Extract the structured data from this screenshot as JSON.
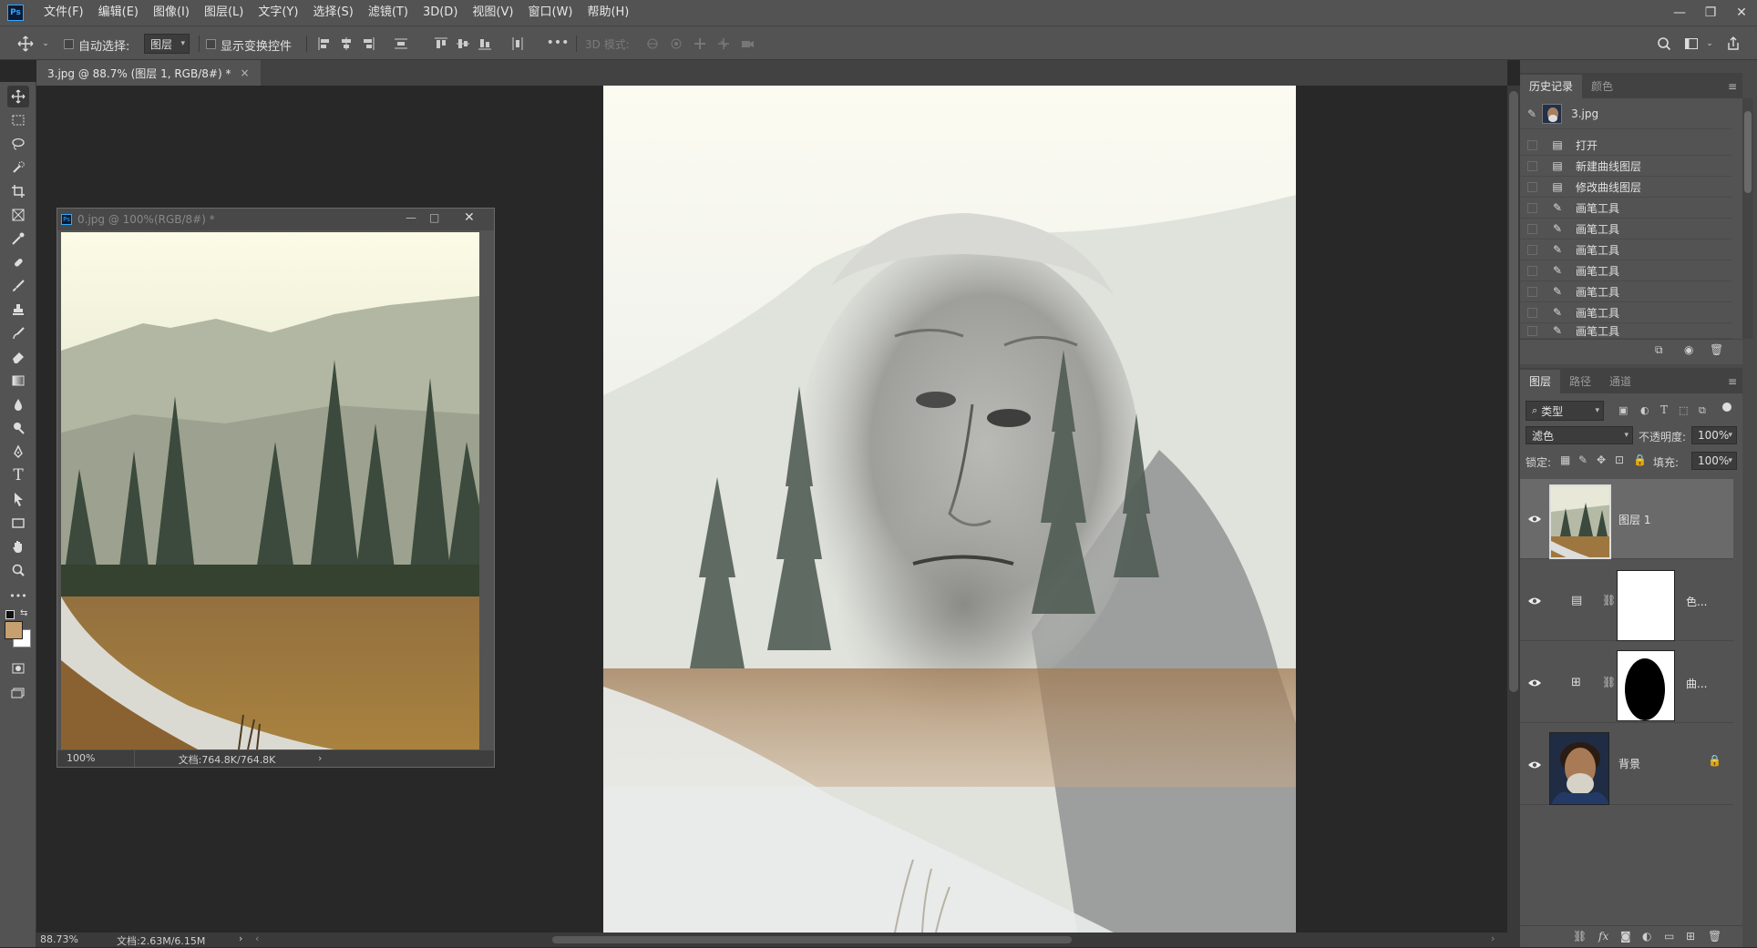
{
  "app": {
    "logo": "Ps"
  },
  "menu": [
    "文件(F)",
    "编辑(E)",
    "图像(I)",
    "图层(L)",
    "文字(Y)",
    "选择(S)",
    "滤镜(T)",
    "3D(D)",
    "视图(V)",
    "窗口(W)",
    "帮助(H)"
  ],
  "window_controls": [
    "—",
    "❐",
    "✕"
  ],
  "options": {
    "auto_select_label": "自动选择:",
    "auto_select_target": "图层",
    "show_transform_label": "显示变换控件",
    "more": "•••",
    "mode_3d_label": "3D 模式:"
  },
  "document_tab": {
    "title": "3.jpg @ 88.7% (图层 1, RGB/8#) *",
    "close": "×"
  },
  "floating_doc": {
    "title": "0.jpg @ 100%(RGB/8#) *",
    "zoom": "100%",
    "doc_info": "文档:764.8K/764.8K"
  },
  "status": {
    "zoom": "88.73%",
    "doc_info": "文档:2.63M/6.15M"
  },
  "history_panel": {
    "tabs": [
      "历史记录",
      "颜色"
    ],
    "snapshot": "3.jpg",
    "items": [
      {
        "label": "打开",
        "icon": "document-icon"
      },
      {
        "label": "新建曲线图层",
        "icon": "document-icon"
      },
      {
        "label": "修改曲线图层",
        "icon": "document-icon"
      },
      {
        "label": "画笔工具",
        "icon": "brush-icon"
      },
      {
        "label": "画笔工具",
        "icon": "brush-icon"
      },
      {
        "label": "画笔工具",
        "icon": "brush-icon"
      },
      {
        "label": "画笔工具",
        "icon": "brush-icon"
      },
      {
        "label": "画笔工具",
        "icon": "brush-icon"
      },
      {
        "label": "画笔工具",
        "icon": "brush-icon"
      },
      {
        "label": "画笔工具",
        "icon": "brush-icon"
      }
    ]
  },
  "layers_panel": {
    "tabs": [
      "图层",
      "路径",
      "通道"
    ],
    "filter_label": "类型",
    "blend_mode": "滤色",
    "opacity_label": "不透明度:",
    "opacity_value": "100%",
    "lock_label": "锁定:",
    "fill_label": "填充:",
    "fill_value": "100%",
    "layers": [
      {
        "name": "图层 1",
        "selected": true
      },
      {
        "name": "色...",
        "selected": false
      },
      {
        "name": "曲...",
        "selected": false
      },
      {
        "name": "背景",
        "selected": false
      }
    ]
  },
  "colors": {
    "foreground": "#c8a070",
    "background": "#ffffff",
    "accent": "#31a8ff"
  }
}
